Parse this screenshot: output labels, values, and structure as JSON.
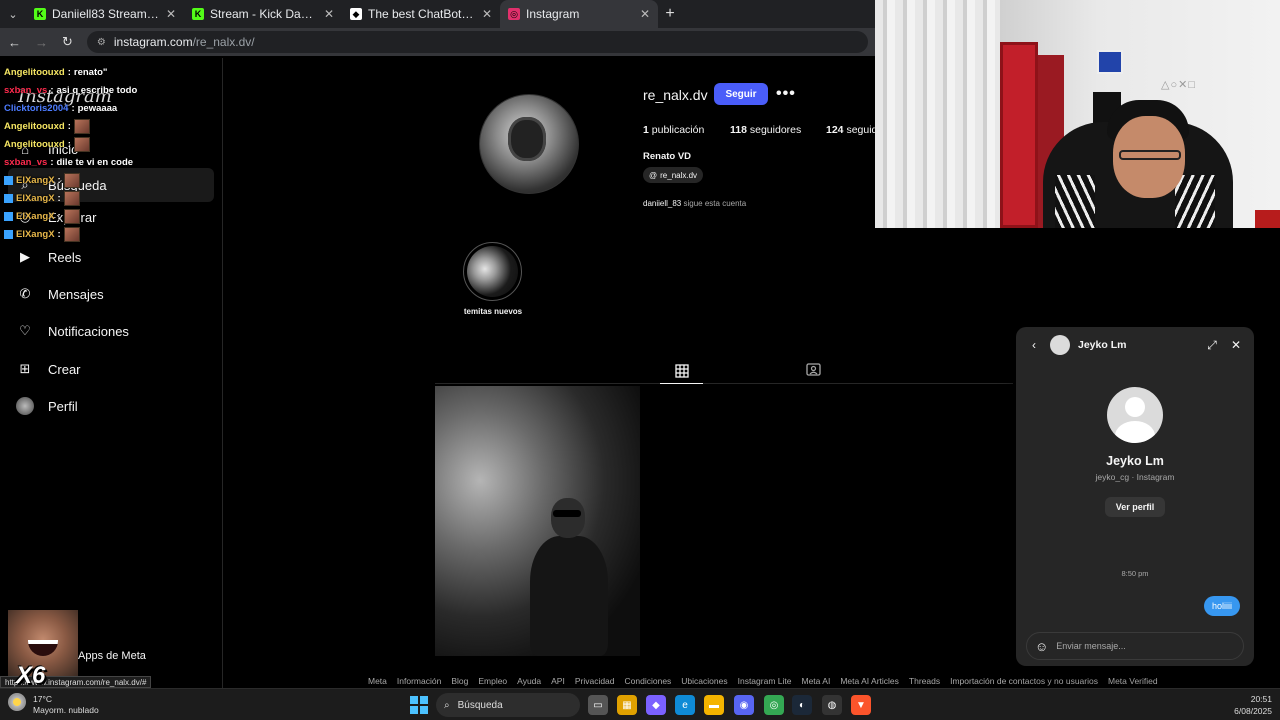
{
  "browser": {
    "tabs": [
      {
        "title": "Daniiell83 Stream - Watch Live",
        "favicon_color": "#53fc18",
        "favicon_glyph": "K",
        "active": false
      },
      {
        "title": "Stream - Kick Dashboard",
        "favicon_color": "#53fc18",
        "favicon_glyph": "K",
        "active": false
      },
      {
        "title": "The best ChatBot and Widgets",
        "favicon_color": "#ffffff",
        "favicon_glyph": "◆",
        "active": false
      },
      {
        "title": "Instagram",
        "favicon_color": "#e1306c",
        "favicon_glyph": "◎",
        "active": true
      }
    ],
    "url_host": "instagram.com",
    "url_path": "/re_nalx.dv/",
    "status_url": "https://www.instagram.com/re_nalx.dv/#"
  },
  "sidebar": {
    "logo": "Instagram",
    "items": [
      {
        "label": "Inicio",
        "icon": "home-icon"
      },
      {
        "label": "Búsqueda",
        "icon": "search-icon"
      },
      {
        "label": "Explorar",
        "icon": "compass-icon"
      },
      {
        "label": "Reels",
        "icon": "reels-icon"
      },
      {
        "label": "Mensajes",
        "icon": "messenger-icon"
      },
      {
        "label": "Notificaciones",
        "icon": "heart-icon"
      },
      {
        "label": "Crear",
        "icon": "plus-square-icon"
      },
      {
        "label": "Perfil",
        "icon": "avatar-icon"
      }
    ],
    "meta_apps": "Apps de Meta"
  },
  "chat_overlay": [
    {
      "user": "Angelitoouxd",
      "color": "#f5e663",
      "text": "renato\"",
      "emote": false,
      "badge": false
    },
    {
      "user": "sxban_vs",
      "color": "#ff2a4d",
      "text": "asi q escribe todo",
      "emote": false,
      "badge": false
    },
    {
      "user": "Clicktoris2004",
      "color": "#4d7cff",
      "text": "pewaaaa",
      "emote": false,
      "badge": false
    },
    {
      "user": "Angelitoouxd",
      "color": "#f5e663",
      "text": "",
      "emote": true,
      "badge": false
    },
    {
      "user": "Angelitoouxd",
      "color": "#f5e663",
      "text": "",
      "emote": true,
      "badge": false
    },
    {
      "user": "sxban_vs",
      "color": "#ff2a4d",
      "text": "dile te vi en code",
      "emote": false,
      "badge": false
    },
    {
      "user": "ElXangX",
      "color": "#e8b84a",
      "text": "",
      "emote": true,
      "badge": true
    },
    {
      "user": "ElXangX",
      "color": "#e8b84a",
      "text": "",
      "emote": true,
      "badge": true
    },
    {
      "user": "ElXangX",
      "color": "#e8b84a",
      "text": "",
      "emote": true,
      "badge": true
    },
    {
      "user": "ElXangX",
      "color": "#e8b84a",
      "text": "",
      "emote": true,
      "badge": true
    }
  ],
  "profile": {
    "username": "re_nalx.dv",
    "follow_label": "Seguir",
    "more_label": "•••",
    "posts_count": "1",
    "posts_label": "publicación",
    "followers_count": "118",
    "followers_label": "seguidores",
    "following_count": "124",
    "following_label": "seguidos",
    "full_name": "Renato VD",
    "threads_handle": "re_nalx.dv",
    "followed_by_user": "daniiell_83",
    "followed_by_text": "sigue esta cuenta",
    "highlight_label": "temitas nuevos"
  },
  "footer_links": [
    "Meta",
    "Información",
    "Blog",
    "Empleo",
    "Ayuda",
    "API",
    "Privacidad",
    "Condiciones",
    "Ubicaciones",
    "Instagram Lite",
    "Meta AI",
    "Meta AI Articles",
    "Threads",
    "Importación de contactos y no usuarios",
    "Meta Verified"
  ],
  "dm": {
    "name": "Jeyko Lm",
    "handle_line": "jeyko_cg · Instagram",
    "view_profile": "Ver perfil",
    "time": "8:50 pm",
    "message": "holiiii",
    "input_placeholder": "Enviar mensaje..."
  },
  "webcam": {
    "sign_text": "△○✕□"
  },
  "overlay": {
    "multiplier": "X6"
  },
  "taskbar": {
    "temp": "17°C",
    "condition": "Mayorm. nublado",
    "search_label": "Búsqueda",
    "time": "20:51",
    "date": "6/08/2025",
    "apps": [
      {
        "name": "task-view",
        "color": "#555555",
        "glyph": "▭"
      },
      {
        "name": "store",
        "color": "#e0a100",
        "glyph": "▦"
      },
      {
        "name": "copilot",
        "color": "#7b61ff",
        "glyph": "◆"
      },
      {
        "name": "edge",
        "color": "#0f8bd6",
        "glyph": "e"
      },
      {
        "name": "file-explorer",
        "color": "#f4b400",
        "glyph": "▬"
      },
      {
        "name": "discord",
        "color": "#5865f2",
        "glyph": "◉"
      },
      {
        "name": "chrome",
        "color": "#34a853",
        "glyph": "◎"
      },
      {
        "name": "steam",
        "color": "#1b2838",
        "glyph": "◐"
      },
      {
        "name": "obs",
        "color": "#333333",
        "glyph": "◍"
      },
      {
        "name": "brave",
        "color": "#fb542b",
        "glyph": "▼"
      }
    ]
  }
}
